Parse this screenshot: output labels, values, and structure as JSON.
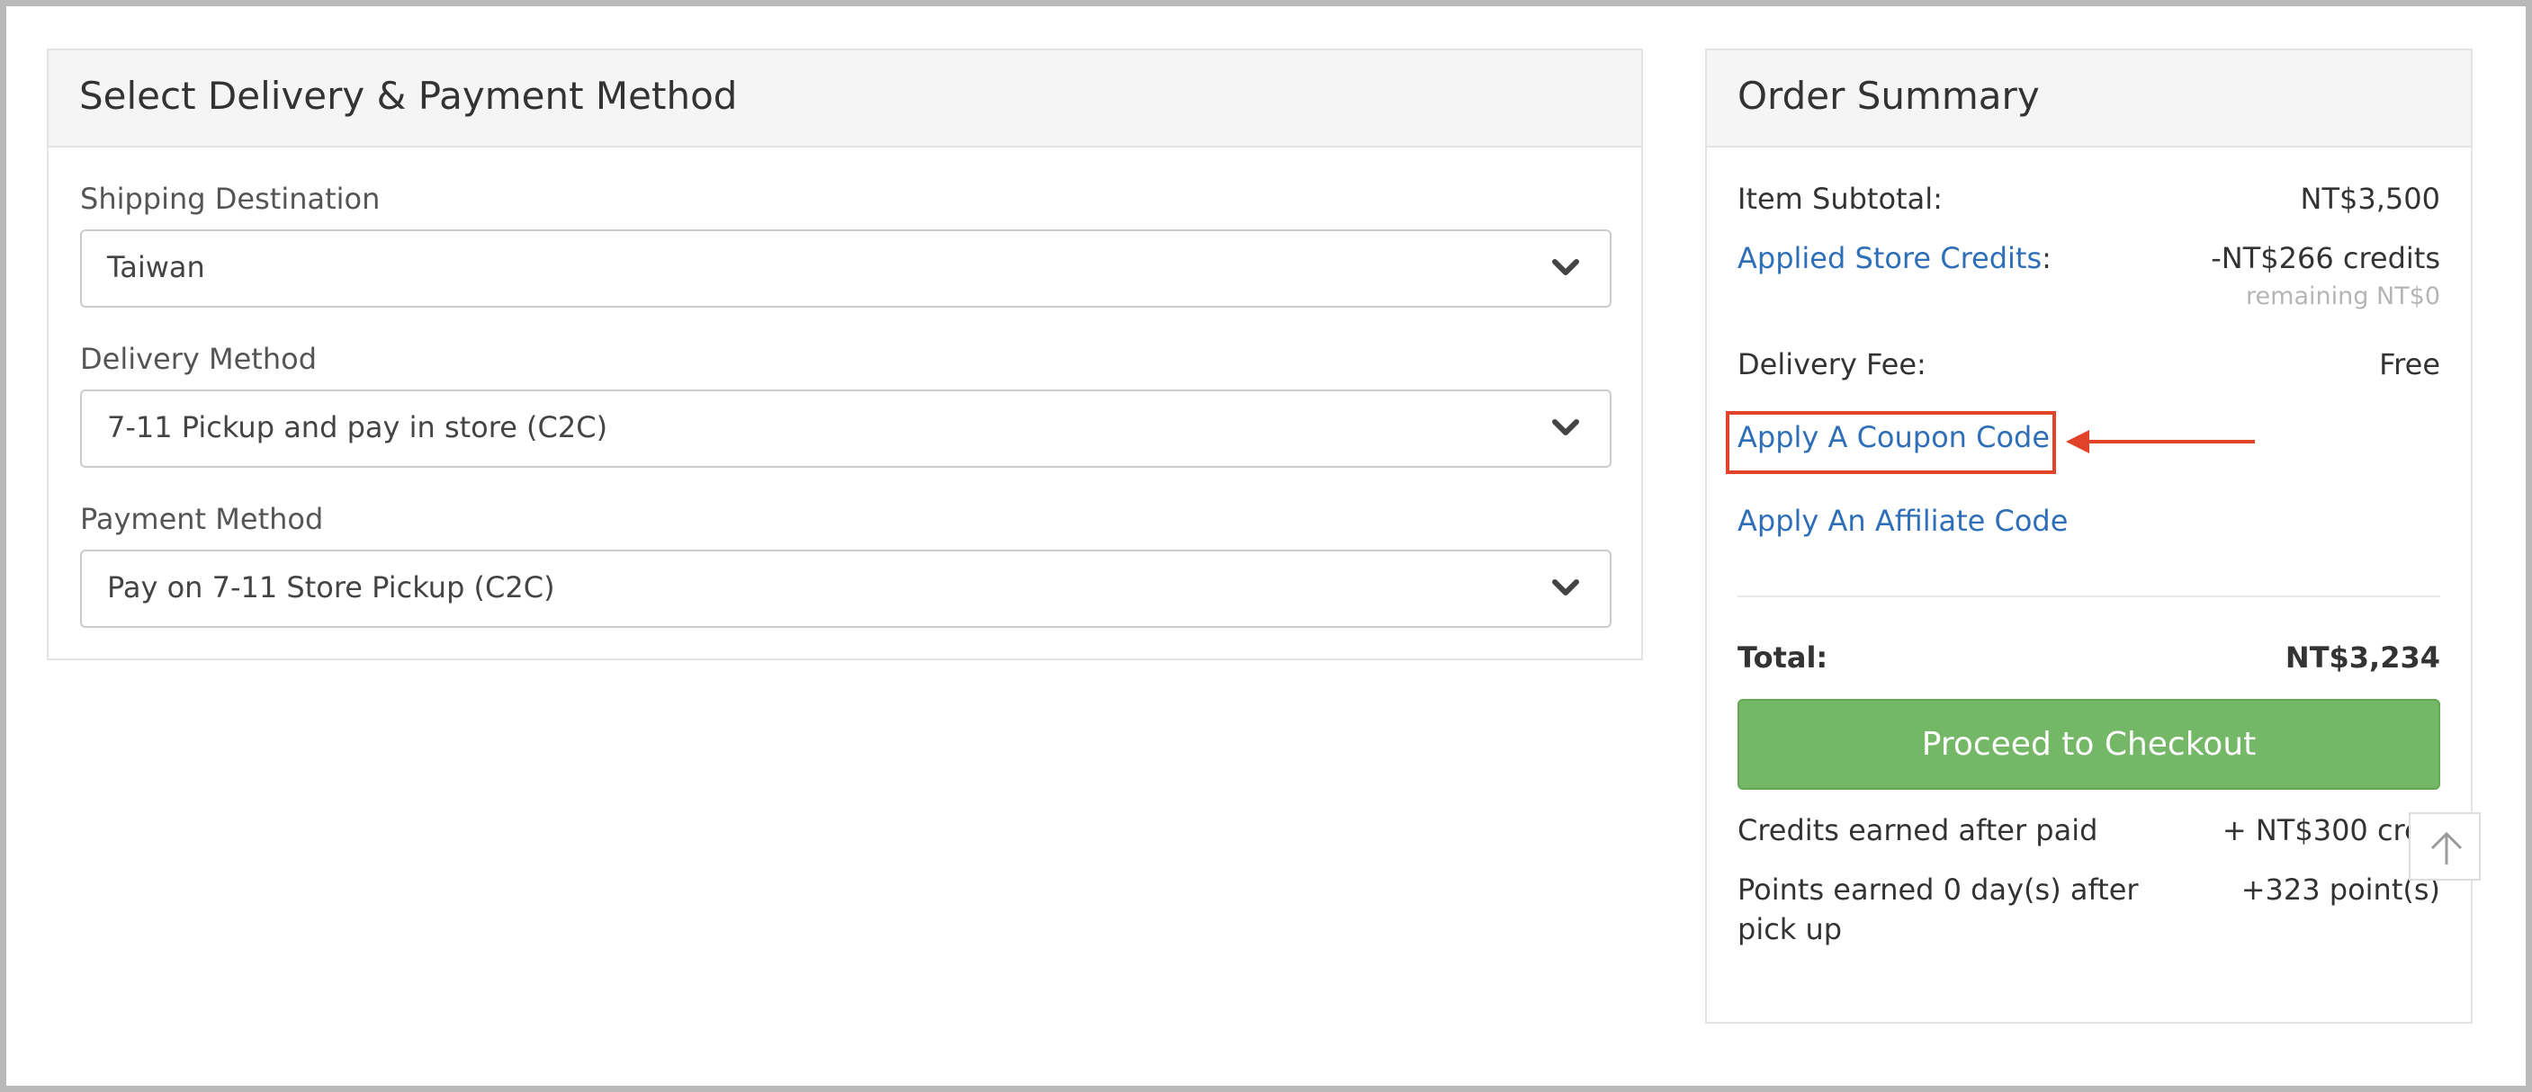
{
  "delivery_panel": {
    "title": "Select Delivery & Payment Method",
    "shipping": {
      "label": "Shipping Destination",
      "value": "Taiwan"
    },
    "delivery": {
      "label": "Delivery Method",
      "value": "7-11 Pickup and pay in store (C2C)"
    },
    "payment": {
      "label": "Payment Method",
      "value": "Pay on 7-11 Store Pickup (C2C)"
    }
  },
  "order_summary": {
    "title": "Order Summary",
    "subtotal_label": "Item Subtotal:",
    "subtotal_value": "NT$3,500",
    "credits_link": "Applied Store Credits",
    "credits_colon": ":",
    "credits_value": "-NT$266 credits",
    "credits_remaining": "remaining NT$0",
    "delivery_fee_label": "Delivery Fee:",
    "delivery_fee_value": "Free",
    "coupon_link": "Apply A Coupon Code",
    "affiliate_link": "Apply An Affiliate Code",
    "total_label": "Total:",
    "total_value": "NT$3,234",
    "checkout_button": "Proceed to Checkout",
    "credits_earned_label": "Credits earned after paid",
    "credits_earned_value": "+ NT$300 cred",
    "points_earned_label_line1": "Points earned 0 day(s) after",
    "points_earned_label_line2": "pick up",
    "points_earned_value": "+323 point(s)"
  },
  "icons": {
    "select_chevron": "chevron-down-icon",
    "scroll_top": "arrow-up-icon",
    "annotation_arrow": "arrow-left-icon"
  },
  "colors": {
    "link": "#2f6fb8",
    "checkout_button": "#74b766",
    "annotation": "#e0432a"
  }
}
